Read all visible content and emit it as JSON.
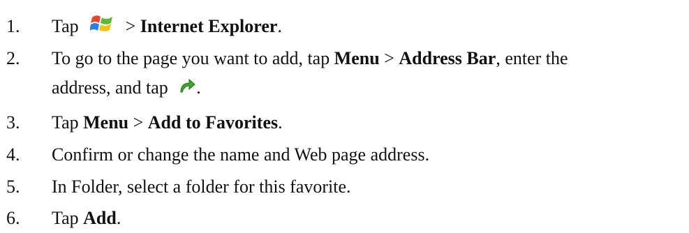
{
  "steps": [
    {
      "number": "1.",
      "tap": "Tap",
      "icon": "windows-start-icon",
      "sep": ">",
      "target": "Internet Explorer",
      "end": "."
    },
    {
      "number": "2.",
      "lead": "To go to the page you want to add, tap",
      "menu": "Menu",
      "sep": ">",
      "address_bar": "Address Bar",
      "tail": ", enter the",
      "line2": "address, and tap",
      "icon": "go-arrow-icon",
      "end": "."
    },
    {
      "number": "3.",
      "tap": "Tap",
      "menu": "Menu",
      "sep": ">",
      "target": "Add to Favorites",
      "end": "."
    },
    {
      "number": "4.",
      "text": "Confirm or change the name and Web page address."
    },
    {
      "number": "5.",
      "text": "In Folder, select a folder for this favorite."
    },
    {
      "number": "6.",
      "tap": "Tap",
      "target": "Add",
      "end": "."
    }
  ]
}
